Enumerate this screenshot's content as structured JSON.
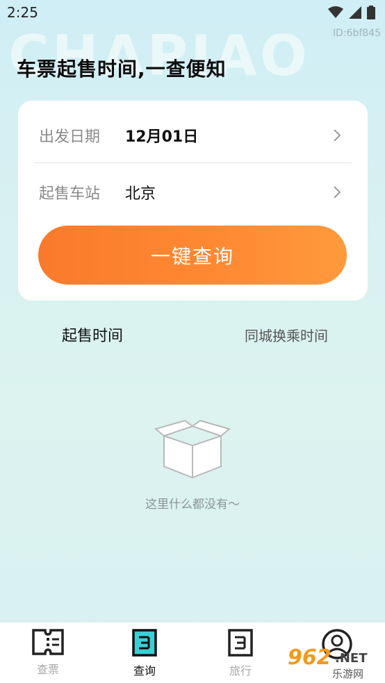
{
  "status_bar": {
    "time": "2:25"
  },
  "background_word": "CHAPIAO",
  "id_tag": "ID:6bf845",
  "page_title": "车票起售时间,一查便知",
  "form": {
    "date_label": "出发日期",
    "date_value": "12月01日",
    "station_label": "起售车站",
    "station_value": "北京",
    "query_button": "一键查询"
  },
  "tabs": [
    {
      "label": "起售时间",
      "active": true
    },
    {
      "label": "同城换乘时间",
      "active": false
    }
  ],
  "empty_state": {
    "text": "这里什么都没有～"
  },
  "bottom_nav": [
    {
      "label": "查票",
      "icon": "ticket-icon",
      "active": false
    },
    {
      "label": "查询",
      "icon": "query-icon",
      "active": true
    },
    {
      "label": "旅行",
      "icon": "travel-icon",
      "active": false
    },
    {
      "label": "",
      "icon": "user-icon",
      "active": false
    }
  ],
  "watermark": {
    "number": "962",
    "suffix": ".NET",
    "text": "乐游网"
  },
  "colors": {
    "accent": "#fa7a2b",
    "accent_end": "#ff9a3d",
    "card": "#ffffff"
  }
}
